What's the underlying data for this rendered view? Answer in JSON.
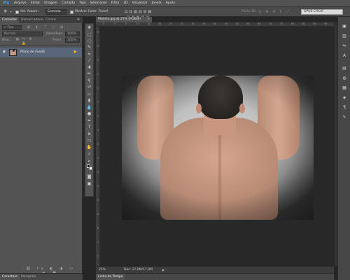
{
  "menu": {
    "logo": "Ps",
    "items": [
      "Arquivo",
      "Editar",
      "Imagem",
      "Camada",
      "Tipo",
      "Selecionar",
      "Filtro",
      "3D",
      "Visualizar",
      "Janela",
      "Ajuda"
    ]
  },
  "options": {
    "auto_select_label": "Sel. Autom.:",
    "auto_select_value": "Camada",
    "show_transform_label": "Mostrar Contr. Transf.",
    "mode_3d_label": "Modo 3D:",
    "workspace": "OPUS CREAT"
  },
  "layers_panel": {
    "tabs": [
      "Camadas",
      "Demarcadores",
      "Canais"
    ],
    "kind_filter": "Tipo",
    "blend_mode": "Normal",
    "opacity_label": "Opacidade:",
    "opacity_value": "100%",
    "lock_label": "Bloq.:",
    "fill_label": "Preen.:",
    "fill_value": "100%",
    "layers": [
      {
        "name": "Plano de Fundo",
        "visible_icon": "eye-icon",
        "locked_icon": "lock-icon"
      }
    ]
  },
  "bottom_tabs": [
    "Caractere",
    "Parágrafo"
  ],
  "document": {
    "tab_title": "Modelo.jpg @ 25% (RGB/8)",
    "ruler_h_ticks": [
      "5",
      "0",
      "5",
      "10",
      "15",
      "20",
      "25",
      "30",
      "35",
      "40",
      "45",
      "50",
      "55",
      "60",
      "65",
      "70",
      "75",
      "80",
      "85",
      "90",
      "95"
    ],
    "ruler_v_ticks": [
      "5",
      "0",
      "5",
      "1",
      "1",
      "2",
      "2",
      "3",
      "3",
      "4",
      "4",
      "5",
      "5",
      "6",
      "6",
      "7",
      "7"
    ]
  },
  "status": {
    "zoom": "25%",
    "doc_info": "Doc: 17,0M/17,0M"
  },
  "timeline_tab": "Linha do Tempo",
  "colors": {
    "menu_bg": "#535353",
    "canvas_bg": "#282828",
    "selected_layer": "#59667a",
    "accent_logo": "#3ba2ff"
  }
}
